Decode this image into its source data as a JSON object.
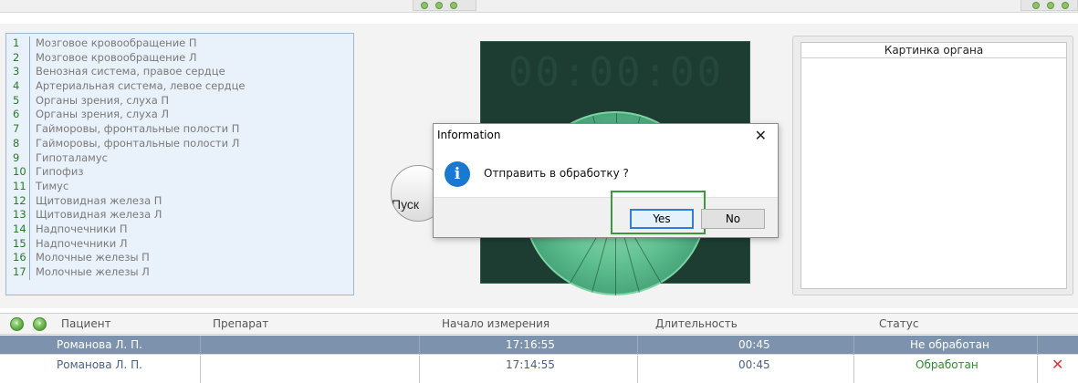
{
  "organ_list": [
    {
      "num": "1",
      "label": "Мозговое кровообращение П"
    },
    {
      "num": "2",
      "label": "Мозговое кровообращение Л"
    },
    {
      "num": "3",
      "label": "Венозная система, правое сердце"
    },
    {
      "num": "4",
      "label": "Артериальная система, левое сердце"
    },
    {
      "num": "5",
      "label": "Органы зрения, слуха П"
    },
    {
      "num": "6",
      "label": "Органы зрения, слуха Л"
    },
    {
      "num": "7",
      "label": "Гайморовы, фронтальные полости П"
    },
    {
      "num": "8",
      "label": "Гайморовы, фронтальные полости Л"
    },
    {
      "num": "9",
      "label": "Гипоталамус"
    },
    {
      "num": "10",
      "label": "Гипофиз"
    },
    {
      "num": "11",
      "label": "Тимус"
    },
    {
      "num": "12",
      "label": "Щитовидная железа П"
    },
    {
      "num": "13",
      "label": "Щитовидная железа Л"
    },
    {
      "num": "14",
      "label": "Надпочечники П"
    },
    {
      "num": "15",
      "label": "Надпочечники Л"
    },
    {
      "num": "16",
      "label": "Молочные железы П"
    },
    {
      "num": "17",
      "label": "Молочные железы Л"
    }
  ],
  "timer": {
    "display": "00:00:00"
  },
  "start_button": {
    "label": "Пуск"
  },
  "organ_picture": {
    "title": "Картинка органа"
  },
  "dialog": {
    "title": "Information",
    "close": "✕",
    "icon": "info-icon",
    "message": "Отправить в обработку ?",
    "yes_label": "Yes",
    "no_label": "No"
  },
  "table": {
    "columns": {
      "patient": "Пациент",
      "drug": "Препарат",
      "start": "Начало измерения",
      "duration": "Длительность",
      "status": "Статус"
    },
    "rows": [
      {
        "patient": "Романова Л. П.",
        "drug": "",
        "start": "17:16:55",
        "duration": "00:45",
        "status": "Не обработан"
      },
      {
        "patient": "Романова Л. П.",
        "drug": "",
        "start": "17:14:55",
        "duration": "00:45",
        "status": "Обработан"
      }
    ]
  },
  "colors": {
    "accent_green": "#3a9b3a",
    "selected_row": "#7d93ad",
    "info_blue": "#1a78d1",
    "delete_red": "#d03a3a"
  }
}
